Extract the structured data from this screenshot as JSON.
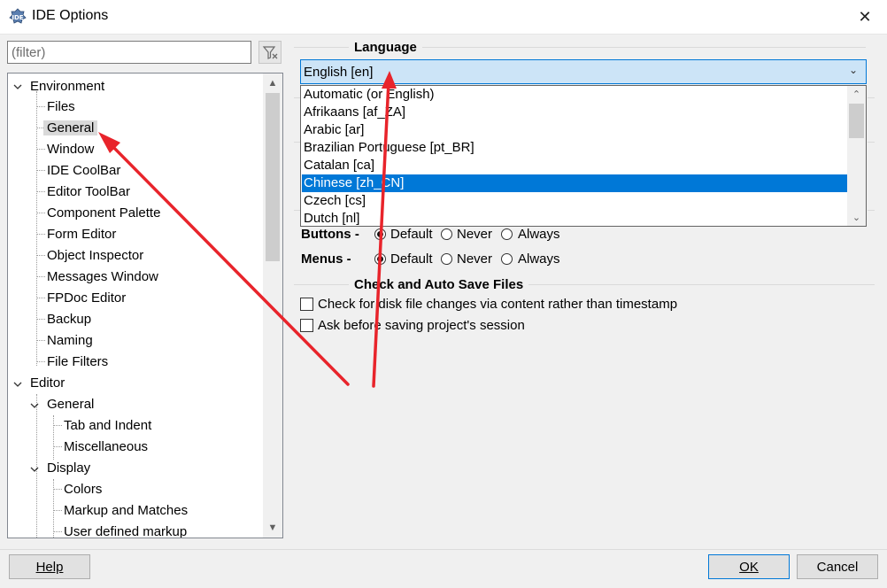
{
  "window": {
    "title": "IDE Options",
    "close_symbol": "✕"
  },
  "filter": {
    "placeholder": "(filter)",
    "value": ""
  },
  "tree": {
    "items": [
      {
        "label": "Environment"
      },
      {
        "label": "Files"
      },
      {
        "label": "General"
      },
      {
        "label": "Window"
      },
      {
        "label": "IDE CoolBar"
      },
      {
        "label": "Editor ToolBar"
      },
      {
        "label": "Component Palette"
      },
      {
        "label": "Form Editor"
      },
      {
        "label": "Object Inspector"
      },
      {
        "label": "Messages Window"
      },
      {
        "label": "FPDoc Editor"
      },
      {
        "label": "Backup"
      },
      {
        "label": "Naming"
      },
      {
        "label": "File Filters"
      },
      {
        "label": "Editor"
      },
      {
        "label": "General"
      },
      {
        "label": "Tab and Indent"
      },
      {
        "label": "Miscellaneous"
      },
      {
        "label": "Display"
      },
      {
        "label": "Colors"
      },
      {
        "label": "Markup and Matches"
      },
      {
        "label": "User defined markup"
      }
    ],
    "selected_index": 2
  },
  "language": {
    "group_title": "Language",
    "selected_value": "English [en]",
    "options": [
      "Automatic (or English)",
      "Afrikaans [af_ZA]",
      "Arabic [ar]",
      "Brazilian Portuguese [pt_BR]",
      "Catalan [ca]",
      "Chinese [zh_CN]",
      "Czech [cs]",
      "Dutch [nl]"
    ],
    "highlighted_index": 5
  },
  "glyphs": {
    "buttons_label": "Buttons -",
    "menus_label": "Menus -",
    "default": "Default",
    "never": "Never",
    "always": "Always",
    "buttons_choice": "Default",
    "menus_choice": "Default"
  },
  "autosave": {
    "group_title": "Check and Auto Save Files",
    "check_disk_label": "Check for disk file changes via content rather than timestamp",
    "check_disk_checked": false,
    "ask_session_label": "Ask before saving project's session",
    "ask_session_checked": false
  },
  "buttons": {
    "help": "Help",
    "ok": "OK",
    "cancel": "Cancel"
  },
  "colors": {
    "selection": "#0078d7",
    "annotation_arrow": "#e8242b",
    "combo_bg": "#cce4f7"
  },
  "icons": {
    "app": "lazarus-app-icon",
    "filter_clear": "filter-clear-icon"
  }
}
